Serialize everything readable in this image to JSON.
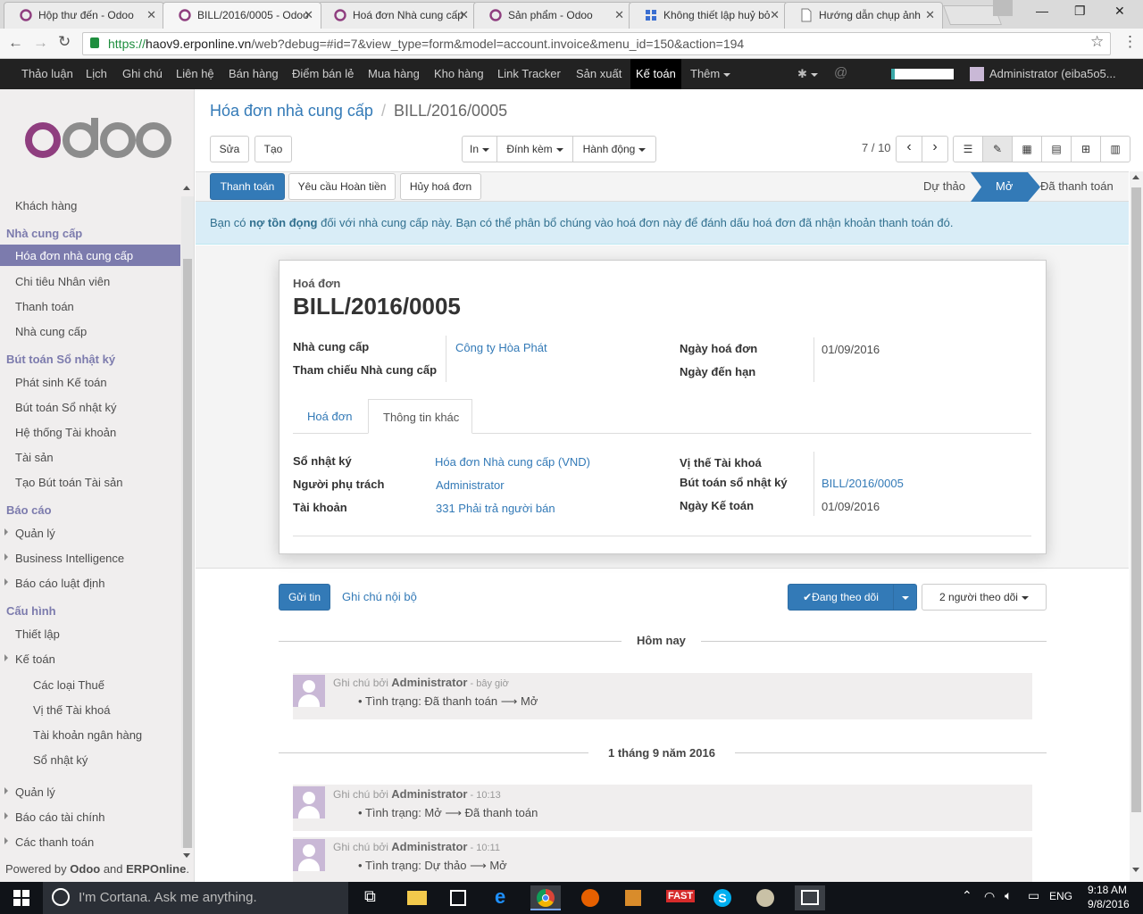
{
  "browser": {
    "tabs": [
      {
        "title": "Hộp thư đến - Odoo",
        "icon": "odoo-circle-icon"
      },
      {
        "title": "BILL/2016/0005 - Odoo",
        "icon": "odoo-circle-icon"
      },
      {
        "title": "Hoá đơn Nhà cung cấp",
        "icon": "odoo-circle-icon"
      },
      {
        "title": "Sản phẩm - Odoo",
        "icon": "odoo-circle-icon"
      },
      {
        "title": "Không thiết lập huỷ bỏ",
        "icon": "grid-icon"
      },
      {
        "title": "Hướng dẫn chụp ảnh",
        "icon": "document-icon"
      }
    ],
    "url_host": "haov9.erponline.vn",
    "url_path": "/web?debug=#id=7&view_type=form&model=account.invoice&menu_id=150&action=194"
  },
  "topnav": {
    "items": [
      "Thảo luận",
      "Lịch",
      "Ghi chú",
      "Liên hệ",
      "Bán hàng",
      "Điểm bán lẻ",
      "Mua hàng",
      "Kho hàng",
      "Link Tracker",
      "Sản xuất",
      "Kế toán",
      "Thêm"
    ],
    "active": "Kế toán",
    "user": "Administrator (eiba5o5..."
  },
  "sidebar": {
    "logo": "odoo",
    "items": [
      {
        "label": "Khách hàng"
      },
      {
        "header": "Nhà cung cấp"
      },
      {
        "label": "Hóa đơn nhà cung cấp",
        "active": true
      },
      {
        "label": "Chi tiêu Nhân viên"
      },
      {
        "label": "Thanh toán"
      },
      {
        "label": "Nhà cung cấp"
      },
      {
        "header": "Bút toán Sổ nhật ký"
      },
      {
        "label": "Phát sinh Kế toán"
      },
      {
        "label": "Bút toán Sổ nhật ký"
      },
      {
        "label": "Hệ thống Tài khoản"
      },
      {
        "label": "Tài sản"
      },
      {
        "label": "Tạo Bút toán Tài sản"
      },
      {
        "header": "Báo cáo"
      },
      {
        "label": "Quản lý",
        "caret": true
      },
      {
        "label": "Business Intelligence",
        "caret": true
      },
      {
        "label": "Báo cáo luật định",
        "caret": true
      },
      {
        "header": "Cấu hình"
      },
      {
        "label": "Thiết lập"
      },
      {
        "label": "Kế toán",
        "caret": true
      },
      {
        "label": "Các loại Thuế",
        "sub": true
      },
      {
        "label": "Vị thế Tài khoá",
        "sub": true
      },
      {
        "label": "Tài khoản ngân hàng",
        "sub": true
      },
      {
        "label": "Sổ nhật ký",
        "sub": true
      },
      {
        "label": "Quản lý",
        "caret": true
      },
      {
        "label": "Báo cáo tài chính",
        "caret": true
      },
      {
        "label": "Các thanh toán",
        "caret": true
      }
    ],
    "footer": {
      "prefix": "Powered by ",
      "brand1": "Odoo",
      "mid": " and ",
      "brand2": "ERPOnline",
      "suffix": "."
    }
  },
  "breadcrumb": {
    "parent": "Hóa đơn nhà cung cấp",
    "sep": "/",
    "current": "BILL/2016/0005"
  },
  "controls": {
    "edit": "Sửa",
    "create": "Tạo",
    "print": "In",
    "attach": "Đính kèm",
    "action": "Hành động",
    "pager": "7 / 10"
  },
  "status_buttons": {
    "pay": "Thanh toán",
    "refund": "Yêu cầu Hoàn tiền",
    "cancel": "Hủy hoá đơn"
  },
  "statusbar": {
    "steps": [
      "Dự thảo",
      "Mở",
      "Đã thanh toán"
    ],
    "active": "Mở"
  },
  "alert": {
    "text1": "Bạn có ",
    "bold": "nợ tồn đọng",
    "text2": " đối với nhà cung cấp này. Bạn có thể phân bổ chúng vào hoá đơn này để đánh dấu hoá đơn đã nhận khoản thanh toán đó."
  },
  "form": {
    "doc_type": "Hoá đơn",
    "number": "BILL/2016/0005",
    "vendor_label": "Nhà cung cấp",
    "vendor": "Công ty Hòa Phát",
    "vendor_ref_label": "Tham chiếu Nhà cung cấp",
    "date_label": "Ngày hoá đơn",
    "date": "01/09/2016",
    "due_label": "Ngày đến hạn",
    "tabs": [
      "Hoá đơn",
      "Thông tin khác"
    ],
    "active_tab": "Thông tin khác",
    "journal_label": "Sổ nhật ký",
    "journal": "Hóa đơn Nhà cung cấp (VND)",
    "responsible_label": "Người phụ trách",
    "responsible": "Administrator",
    "account_label": "Tài khoản",
    "account": "331 Phải trả người bán",
    "fiscal_label": "Vị thế Tài khoá",
    "move_label": "Bút toán sổ nhật ký",
    "move": "BILL/2016/0005",
    "acc_date_label": "Ngày Kế toán",
    "acc_date": "01/09/2016"
  },
  "chatter": {
    "send": "Gửi tin",
    "note": "Ghi chú nội bộ",
    "following": "Đang theo dõi",
    "followers": "2 người theo dõi",
    "day1": "Hôm nay",
    "day2": "1 tháng 9 năm 2016",
    "messages": [
      {
        "prefix": "Ghi chú bởi ",
        "author": "Administrator",
        "time": " - bây giờ",
        "field": "Tình trạng: ",
        "from": "Đã thanh toán",
        "to": "Mở"
      },
      {
        "prefix": "Ghi chú bởi ",
        "author": "Administrator",
        "time": " - 10:13",
        "field": "Tình trạng: ",
        "from": "Mở",
        "to": "Đã thanh toán"
      },
      {
        "prefix": "Ghi chú bởi ",
        "author": "Administrator",
        "time": " - 10:11",
        "field": "Tình trạng: ",
        "from": "Dự thảo",
        "to": "Mở"
      }
    ]
  },
  "taskbar": {
    "search": "I'm Cortana. Ask me anything.",
    "lang": "ENG",
    "time": "9:18 AM",
    "date": "9/8/2016"
  }
}
